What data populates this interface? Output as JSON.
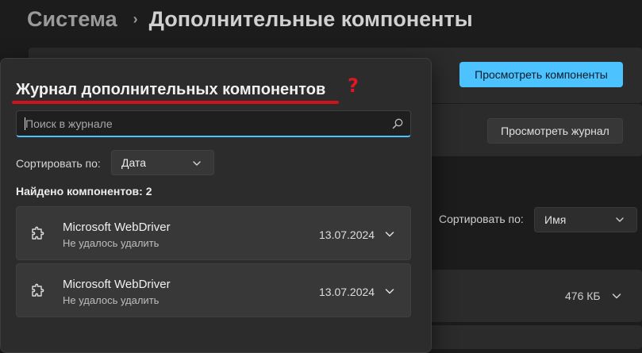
{
  "breadcrumb": {
    "parent": "Система",
    "separator": "›",
    "current": "Дополнительные компоненты"
  },
  "background": {
    "view_features_button": "Просмотреть компоненты",
    "view_history_button": "Просмотреть журнал",
    "sort_label": "Сортировать по:",
    "sort_value": "Имя",
    "size_text": "476 КБ"
  },
  "flyout": {
    "title": "Журнал дополнительных компонентов",
    "help_mark": "?",
    "search_placeholder": "Поиск в журнале",
    "sort_label": "Сортировать по:",
    "sort_value": "Дата",
    "found_text": "Найдено компонентов: 2",
    "items": [
      {
        "name": "Microsoft WebDriver",
        "status": "Не удалось удалить",
        "date": "13.07.2024"
      },
      {
        "name": "Microsoft WebDriver",
        "status": "Не удалось удалить",
        "date": "13.07.2024"
      }
    ]
  },
  "colors": {
    "accent": "#4cc2ff",
    "annotation_red": "#d0121b",
    "background": "#1c1c1c",
    "flyout": "#2c2c2c"
  },
  "icons": [
    "search-icon",
    "chevron-down-icon",
    "puzzle-icon",
    "question-mark-icon"
  ]
}
